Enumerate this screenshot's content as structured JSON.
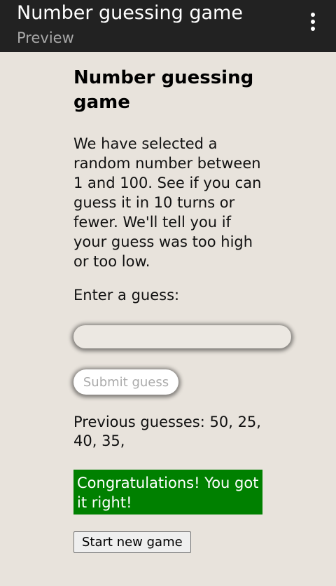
{
  "appbar": {
    "title": "Number guessing game",
    "subtitle": "Preview",
    "menu_icon": "more-vertical-icon"
  },
  "game": {
    "heading": "Number guessing game",
    "description": "We have selected a random number between 1 and 100. See if you can guess it in 10 turns or fewer. We'll tell you if your guess was too high or too low.",
    "guess_label": "Enter a guess:",
    "guess_value": "",
    "submit_label": "Submit guess",
    "previous_label": "Previous guesses:",
    "previous_values": "50, 25, 40, 35,",
    "result_message": "Congratulations! You got it right!",
    "new_game_label": "Start new game"
  },
  "colors": {
    "appbar_bg": "#222222",
    "page_bg": "#e8e3dc",
    "success_bg": "#008000"
  }
}
